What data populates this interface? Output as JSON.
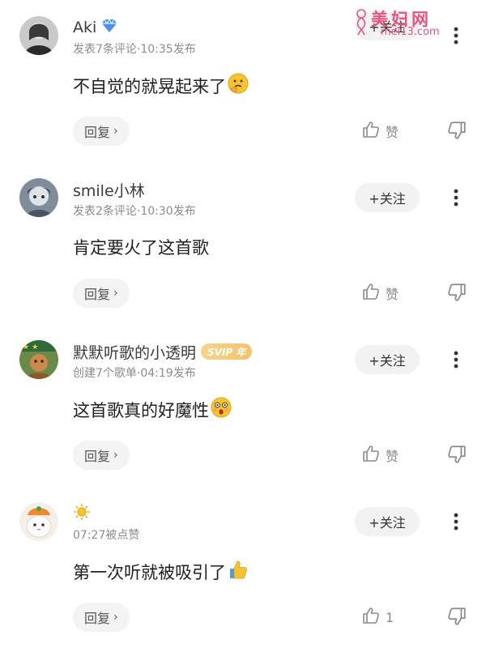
{
  "watermark": {
    "title": "美妇网",
    "url": "mei13.com"
  },
  "comments": [
    {
      "username": "Aki",
      "meta": "发表7条评论·10:35发布",
      "content": "不自觉的就晃起来了",
      "reply_label": "回复",
      "follow_label": "+关注",
      "like_label": "赞",
      "emoji": "thinking-face-emoji",
      "badge_icon": "diamond-icon"
    },
    {
      "username": "smile小林",
      "meta": "发表2条评论·10:30发布",
      "content": "肯定要火了这首歌",
      "reply_label": "回复",
      "follow_label": "+关注",
      "like_label": "赞"
    },
    {
      "username": "默默听歌的小透明",
      "badge": "SVIP 年",
      "meta": "创建7个歌单·04:19发布",
      "content": "这首歌真的好魔性",
      "reply_label": "回复",
      "follow_label": "+关注",
      "like_label": "赞",
      "emoji": "astonished-face-emoji"
    },
    {
      "username_icon": "sun-icon",
      "meta": "07:27被点赞",
      "content": "第一次听就被吸引了",
      "reply_label": "回复",
      "follow_label": "+关注",
      "like_label": "1",
      "emoji": "thumbs-up-emoji"
    }
  ],
  "colors": {
    "vip_gold": "#f3c36a",
    "diamond_blue": "#4a8fe8",
    "watermark_pink": "#e8547e"
  }
}
